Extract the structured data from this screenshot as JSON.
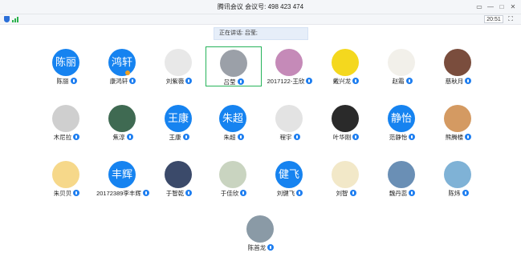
{
  "window": {
    "title": "腾讯会议 会议号: 498 423 474"
  },
  "toolbar": {
    "time": "20:51"
  },
  "speaking": {
    "text": "正在讲话: 吕莹;"
  },
  "participants": [
    {
      "name": "陈丽",
      "avatar_text": "陈丽",
      "avatar_color": "#1683f0"
    },
    {
      "name": "康鸿轩",
      "avatar_text": "鸿轩",
      "avatar_color": "#1683f0"
    },
    {
      "name": "刘紫薇",
      "avatar_text": "",
      "avatar_color": "#e8e8e8"
    },
    {
      "name": "吕莹",
      "avatar_text": "",
      "avatar_color": "#9ba0a8"
    },
    {
      "name": "2017122-王欣",
      "avatar_text": "",
      "avatar_color": "#c58ab8"
    },
    {
      "name": "戴兴龙",
      "avatar_text": "",
      "avatar_color": "#f4d81e"
    },
    {
      "name": "赵霜",
      "avatar_text": "",
      "avatar_color": "#f2f0ea"
    },
    {
      "name": "慈秋月",
      "avatar_text": "",
      "avatar_color": "#7a4d3d"
    },
    {
      "name": "木尼拉",
      "avatar_text": "",
      "avatar_color": "#cfcfcf"
    },
    {
      "name": "焦淳",
      "avatar_text": "",
      "avatar_color": "#3f6a52"
    },
    {
      "name": "王康",
      "avatar_text": "王康",
      "avatar_color": "#1683f0"
    },
    {
      "name": "朱超",
      "avatar_text": "朱超",
      "avatar_color": "#1683f0"
    },
    {
      "name": "程宇",
      "avatar_text": "",
      "avatar_color": "#e3e3e3"
    },
    {
      "name": "叶华刚",
      "avatar_text": "",
      "avatar_color": "#2a2a2a"
    },
    {
      "name": "范静怡",
      "avatar_text": "静怡",
      "avatar_color": "#1683f0"
    },
    {
      "name": "熊腾楼",
      "avatar_text": "",
      "avatar_color": "#d49a62"
    },
    {
      "name": "朱贝贝",
      "avatar_text": "",
      "avatar_color": "#f6d88a"
    },
    {
      "name": "20172389李丰辉",
      "avatar_text": "丰辉",
      "avatar_color": "#1683f0"
    },
    {
      "name": "于智乾",
      "avatar_text": "",
      "avatar_color": "#3b4a6a"
    },
    {
      "name": "于佳欣",
      "avatar_text": "",
      "avatar_color": "#c9d4c0"
    },
    {
      "name": "刘健飞",
      "avatar_text": "健飞",
      "avatar_color": "#1683f0"
    },
    {
      "name": "刘智",
      "avatar_text": "",
      "avatar_color": "#f2e8c8"
    },
    {
      "name": "魏丹蕊",
      "avatar_text": "",
      "avatar_color": "#6a8fb5"
    },
    {
      "name": "陈炜",
      "avatar_text": "",
      "avatar_color": "#7fb2d6"
    },
    {
      "name": "陈首龙",
      "avatar_text": "",
      "avatar_color": "#8a9aa6"
    }
  ]
}
